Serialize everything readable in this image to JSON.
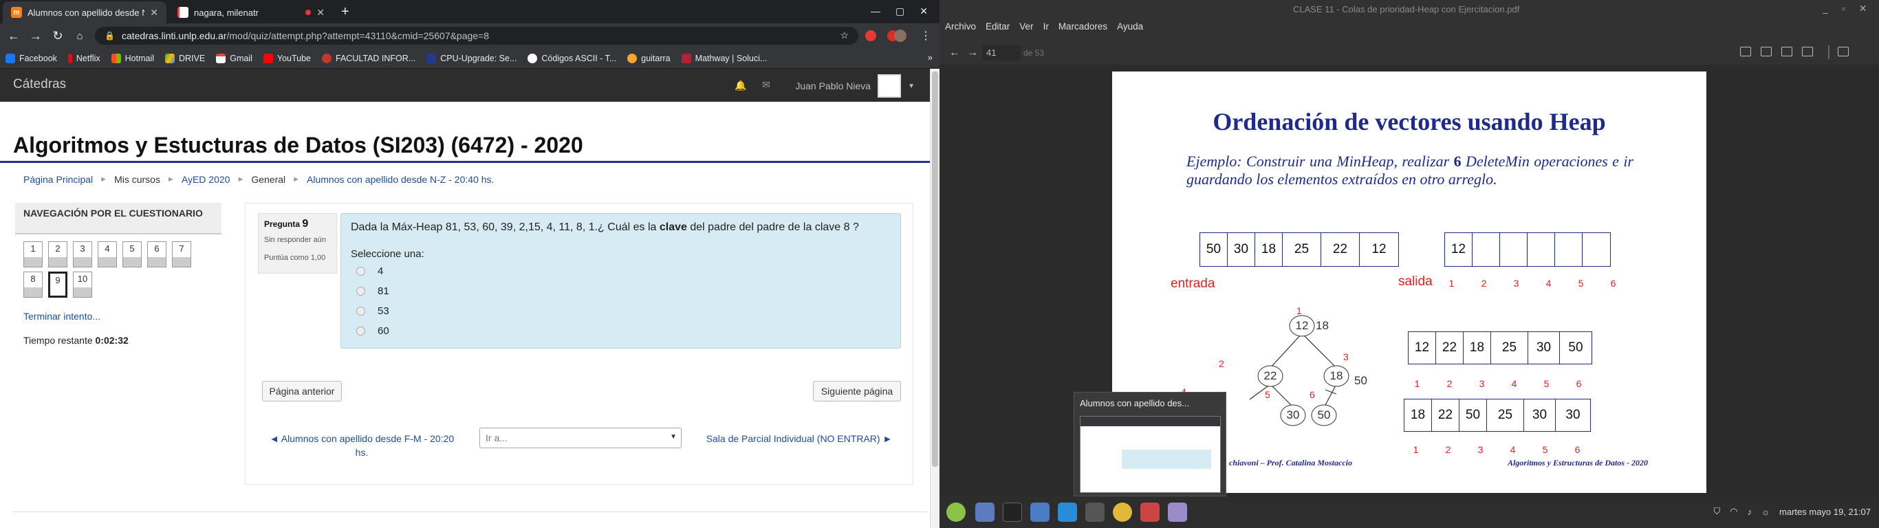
{
  "browser": {
    "tabs": [
      {
        "title": "Alumnos con apellido desde N",
        "favicon": "m",
        "active": true
      },
      {
        "title": "nagara, milenatr",
        "favicon": "doc",
        "active": false
      }
    ],
    "url_host": "catedras.linti.unlp.edu.ar",
    "url_path": "/mod/quiz/attempt.php?attempt=43110&cmid=25607&page=8",
    "bookmarks": [
      "Facebook",
      "Netflix",
      "Hotmail",
      "DRIVE",
      "Gmail",
      "YouTube",
      "FACULTAD INFOR...",
      "CPU-Upgrade: Se...",
      "Códigos ASCII - T...",
      "guitarra",
      "Mathway | Soluci..."
    ],
    "bookmark_colors": [
      "#1877f2",
      "#e50914",
      "#f25022",
      "#34a853",
      "#ea4335",
      "#ff0000",
      "#c0392b",
      "#223a8f",
      "#ffffff",
      "#f4a534",
      "#b22234"
    ]
  },
  "moodle": {
    "brand": "Cátedras",
    "user": "Juan Pablo Nieva",
    "page_title": "Algoritmos y Estucturas de Datos (SI203) (6472) - 2020",
    "breadcrumb": [
      "Página Principal",
      "Mis cursos",
      "AyED 2020",
      "General",
      "Alumnos con apellido desde N-Z - 20:40 hs."
    ],
    "nav_title": "NAVEGACIÓN POR EL CUESTIONARIO",
    "nav_buttons": [
      "1",
      "2",
      "3",
      "4",
      "5",
      "6",
      "7",
      "8",
      "9",
      "10"
    ],
    "finish_link": "Terminar intento...",
    "timer_label": "Tiempo restante",
    "timer_value": "0:02:32",
    "question": {
      "label": "Pregunta",
      "number": "9",
      "status": "Sin responder aún",
      "score": "Puntúa como 1,00",
      "text_before": "Dada la Máx-Heap 81, 53, 60, 39, 2,15, 4, 11, 8, 1.¿ Cuál es la ",
      "text_bold": "clave",
      "text_after": " del padre del padre de la clave 8 ?",
      "prompt": "Seleccione una:",
      "options": [
        "4",
        "81",
        "53",
        "60"
      ]
    },
    "prev_page": "Página anterior",
    "next_page": "Siguiente página",
    "prev_activity": "◄ Alumnos con apellido desde F-M - 20:20 hs.",
    "jump_placeholder": "Ir a...",
    "next_activity": "Sala de Parcial Individual (NO ENTRAR) ►"
  },
  "pdf": {
    "menu": [
      "Archivo",
      "Editar",
      "Ver",
      "Ir",
      "Marcadores",
      "Ayuda"
    ],
    "window_title": "CLASE 11 - Colas de prioridad-Heap con Ejercitacion.pdf",
    "page_current": "41",
    "page_total": "de 53",
    "slide": {
      "title": "Ordenación de vectores usando Heap",
      "text_a": "Ejemplo: Construir una MinHeap, realizar ",
      "text_num": "6",
      "text_b": " DeleteMin operaciones e ir guardando los elementos extraídos en otro arreglo.",
      "entrada_label": "entrada",
      "entrada": [
        "50",
        "30",
        "18",
        "25",
        "22",
        "12"
      ],
      "salida_label": "salida",
      "salida": [
        "12",
        "",
        "",
        "",
        "",
        ""
      ],
      "salida_idx": [
        "1",
        "2",
        "3",
        "4",
        "5",
        "6"
      ],
      "arr_a": [
        "12",
        "22",
        "18",
        "25",
        "30",
        "50"
      ],
      "arr_b": [
        "18",
        "22",
        "50",
        "25",
        "30",
        "30"
      ],
      "idx": [
        "1",
        "2",
        "3",
        "4",
        "5",
        "6"
      ],
      "tree_nodes": [
        "12",
        "22",
        "18",
        "30",
        "50"
      ],
      "tree_side_labels": [
        "18",
        "50"
      ],
      "tree_pos_labels": [
        "1",
        "2",
        "3",
        "4",
        "5",
        "6"
      ],
      "footer_left": "chiavoni – Prof. Catalina Mostaccio",
      "footer_right": "Algoritmos y Estructuras de Datos - 2020"
    }
  },
  "popup_title": "Alumnos con apellido des...",
  "taskbar": {
    "clock": "martes mayo 19, 21:07"
  }
}
